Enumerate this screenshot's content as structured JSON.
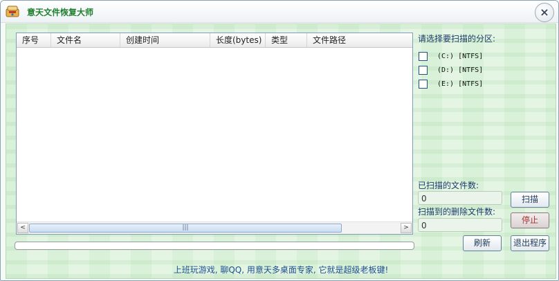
{
  "window": {
    "title": "意天文件恢复大师",
    "close_glyph": "×"
  },
  "file_list": {
    "columns": [
      "序号",
      "文件名",
      "创建时间",
      "长度(bytes)",
      "类型",
      "文件路径"
    ],
    "rows": [],
    "hscroll_left": "<",
    "hscroll_right": ">",
    "hscroll_grip": "|||"
  },
  "scan_progress_fraction": 0,
  "partitions": {
    "heading": "请选择要扫描的分区:",
    "items": [
      {
        "label": "(C:) [NTFS]",
        "checked": false
      },
      {
        "label": "(D:) [NTFS]",
        "checked": false
      },
      {
        "label": "(E:) [NTFS]",
        "checked": false
      }
    ]
  },
  "stats": {
    "scanned_label": "已扫描的文件数:",
    "scanned_value": "0",
    "deleted_label": "扫描到的删除文件数:",
    "deleted_value": "0"
  },
  "buttons": {
    "scan": "扫描",
    "stop": "停止",
    "refresh": "刷新",
    "exit": "退出程序"
  },
  "footer": {
    "slogan": "上班玩游戏, 聊QQ, 用意天多桌面专家, 它就是超级老板键!"
  },
  "icons": {
    "app": "app-logo-icon",
    "close": "close-icon"
  },
  "colors": {
    "title_text": "#1d7f2e",
    "content_bg": "#e4f5e4",
    "slogan_text": "#1d4f8f",
    "stop_text": "#aa3333"
  }
}
